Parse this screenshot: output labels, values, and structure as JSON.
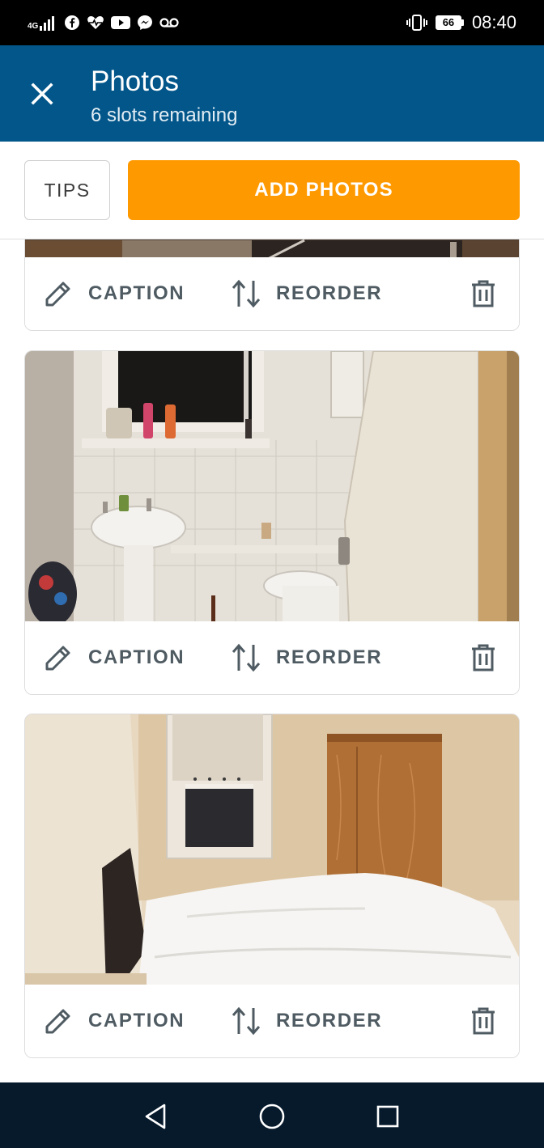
{
  "status_bar": {
    "network": "4G",
    "battery": "66",
    "time": "08:40",
    "icons": [
      "signal-icon",
      "facebook-icon",
      "health-icon",
      "youtube-icon",
      "messenger-icon",
      "voicemail-icon",
      "vibrate-icon",
      "battery-icon"
    ]
  },
  "header": {
    "title": "Photos",
    "subtitle": "6 slots remaining",
    "close_icon": "close-icon",
    "background": "#02568a"
  },
  "actions": {
    "tips_label": "TIPS",
    "add_label": "ADD PHOTOS",
    "accent": "#ff9900"
  },
  "photos": [
    {
      "subject": "dark room corner",
      "caption_label": "CAPTION",
      "reorder_label": "REORDER"
    },
    {
      "subject": "bathroom with sink and toilet",
      "caption_label": "CAPTION",
      "reorder_label": "REORDER"
    },
    {
      "subject": "bedroom with bed and wardrobe",
      "caption_label": "CAPTION",
      "reorder_label": "REORDER"
    }
  ],
  "nav": {
    "icons": [
      "back-icon",
      "home-icon",
      "recents-icon"
    ]
  }
}
